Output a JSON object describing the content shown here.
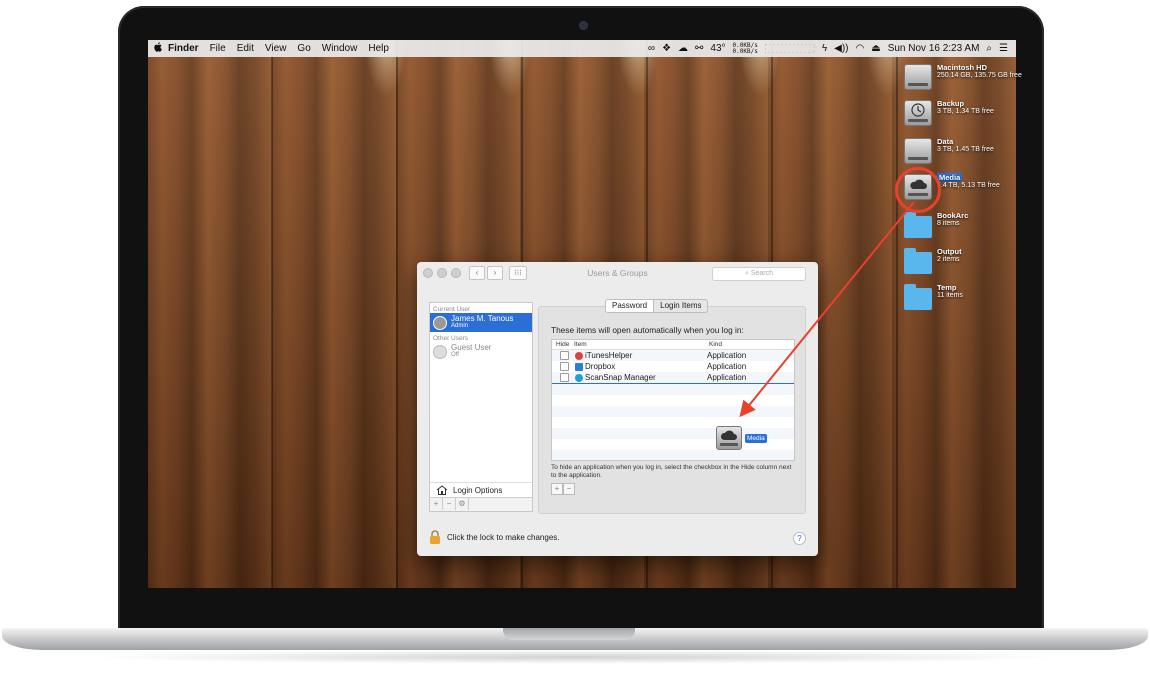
{
  "menubar": {
    "apple": "",
    "items": [
      "Finder",
      "File",
      "Edit",
      "View",
      "Go",
      "Window",
      "Help"
    ],
    "status_temp": "43°",
    "net_up": "0.0KB/s",
    "net_down": "0.0KB/s",
    "clock": "Sun Nov 16  2:23 AM"
  },
  "desktop": {
    "items": [
      {
        "name": "Macintosh HD",
        "info": "250.14 GB, 135.75 GB free",
        "kind": "drive"
      },
      {
        "name": "Backup",
        "info": "3 TB, 1.34 TB free",
        "kind": "drive"
      },
      {
        "name": "Data",
        "info": "3 TB, 1.45 TB free",
        "kind": "drive"
      },
      {
        "name": "Media",
        "info": "5.4 TB, 5.13 TB free",
        "kind": "drive"
      },
      {
        "name": "BookArc",
        "info": "8 items",
        "kind": "folder"
      },
      {
        "name": "Output",
        "info": "2 items",
        "kind": "folder"
      },
      {
        "name": "Temp",
        "info": "11 items",
        "kind": "folder"
      }
    ]
  },
  "window": {
    "title": "Users & Groups",
    "search_placeholder": "Search",
    "sidebar": {
      "current_user_header": "Current User",
      "current_user": {
        "name": "James M. Tanous",
        "role": "Admin"
      },
      "other_users_header": "Other Users",
      "guest": {
        "name": "Guest User",
        "status": "Off"
      },
      "login_options": "Login Options"
    },
    "tabs": [
      "Password",
      "Login Items"
    ],
    "caption": "These items will open automatically when you log in:",
    "columns": {
      "hide": "Hide",
      "item": "Item",
      "kind": "Kind"
    },
    "rows": [
      {
        "item": "iTunesHelper",
        "kind": "Application",
        "icon_color": "#e2413b"
      },
      {
        "item": "Dropbox",
        "kind": "Application",
        "icon_color": "#2a7fd8"
      },
      {
        "item": "ScanSnap Manager",
        "kind": "Application",
        "icon_color": "#1e9fd6"
      }
    ],
    "drag_label": "Media",
    "hint": "To hide an application when you log in, select the checkbox in the Hide column next to the application.",
    "lock_text": "Click the lock to make changes.",
    "help": "?"
  },
  "colors": {
    "selection": "#2a6fd6",
    "annotation": "#e8412c"
  }
}
